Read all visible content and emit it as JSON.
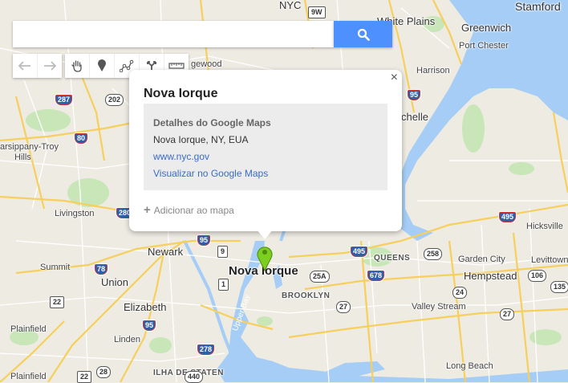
{
  "search": {
    "value": "",
    "placeholder": "",
    "button_icon": "search-icon",
    "button_color": "#4d90fe"
  },
  "toolbar": {
    "groups": [
      [
        "undo-icon",
        "redo-icon"
      ],
      [
        "hand-icon",
        "marker-icon",
        "draw-line-icon",
        "directions-icon",
        "ruler-icon"
      ]
    ]
  },
  "popup": {
    "title": "Nova Iorque",
    "close": "×",
    "details_heading": "Detalhes do Google Maps",
    "address": "Nova Iorque, NY, EUA",
    "website": "www.nyc.gov",
    "view_link": "Visualizar no Google Maps",
    "add_to_map": "Adicionar ao mapa"
  },
  "marker": {
    "color": "#7ccf1e"
  },
  "map": {
    "water_color": "#a5cdf5",
    "labels": {
      "stamford": "Stamford",
      "nyc_top": "NYC",
      "white_plains": "White Plains",
      "greenwich": "Greenwich",
      "port_chester": "Port Chester",
      "ridgewood": "gewood",
      "harrison": "Harrison",
      "rochelle": "chelle",
      "parsippany": "arsippany-Troy",
      "hills": "Hills",
      "livingston": "Livingston",
      "newark": "Newark",
      "nova_iorque": "Nova Iorque",
      "queens": "QUEENS",
      "summit": "Summit",
      "union": "Union",
      "garden_city": "Garden City",
      "hempstead": "Hempstead",
      "levittown": "Levittown",
      "hicksville": "Hicksville",
      "brooklyn": "BROOKLYN",
      "elizabeth": "Elizabeth",
      "valley_stream": "Valley Stream",
      "plainfield": "Plainfield",
      "linden": "Linden",
      "ilha_de_staten": "ILHA DE STATEN",
      "long_beach": "Long Beach",
      "upper_bay": "Upper Bay",
      "fieldfield": "Plainfield"
    },
    "shields": {
      "s9w": "9W",
      "s287": "287",
      "s202": "202",
      "s95a": "95",
      "s80": "80",
      "s280": "280",
      "s95b": "95",
      "s9": "9",
      "s495a": "495",
      "s495b": "495",
      "s78": "78",
      "s1": "1",
      "s22": "22",
      "s678": "678",
      "s25a": "25A",
      "s258": "258",
      "s106": "106",
      "s135": "135",
      "s27a": "27",
      "s27b": "27",
      "s24": "24",
      "s95c": "95",
      "s278": "278",
      "s440": "440",
      "s28": "28",
      "s22b": "22"
    }
  }
}
